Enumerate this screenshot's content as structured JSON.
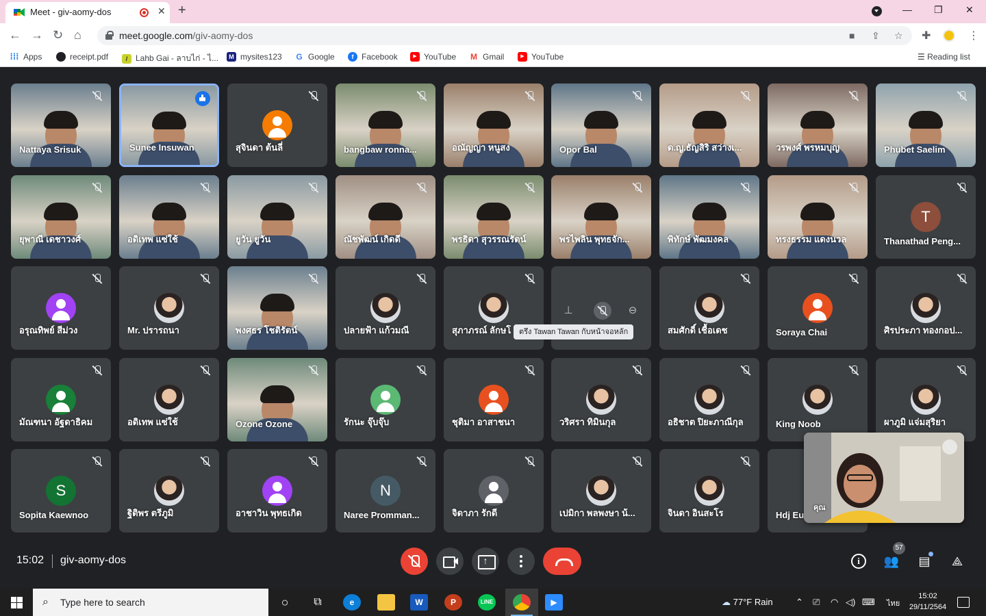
{
  "browser": {
    "tab_title": "Meet - giv-aomy-dos",
    "url_host": "meet.google.com",
    "url_path": "/giv-aomy-dos",
    "bookmarks": [
      "Apps",
      "receipt.pdf",
      "Lahb Gai - ลาบไก่ - ไ...",
      "mysites123",
      "Google",
      "Facebook",
      "YouTube",
      "Gmail",
      "YouTube"
    ],
    "reading_list": "Reading list"
  },
  "participants": [
    {
      "name": "Nattaya Srisuk",
      "kind": "video"
    },
    {
      "name": "Sunee Insuwan",
      "kind": "video",
      "speaking": true
    },
    {
      "name": "สุจินดา ต้นลี่",
      "kind": "avatar",
      "color": "#f57c00"
    },
    {
      "name": "bangbaw ronna...",
      "kind": "video"
    },
    {
      "name": "อณัญญา หนูสง",
      "kind": "video"
    },
    {
      "name": "Opor Bal",
      "kind": "video"
    },
    {
      "name": "ด.ญ.ธัญสิริ สว่างเ...",
      "kind": "video"
    },
    {
      "name": "วรพงศ์ พรหมบุญ",
      "kind": "video"
    },
    {
      "name": "Phubet Saelim",
      "kind": "video"
    },
    {
      "name": "ยุพาณี เดชาวงศ์",
      "kind": "video"
    },
    {
      "name": "อดิเทพ แซ่ใช้",
      "kind": "video"
    },
    {
      "name": "ยูวัน ยูวัน",
      "kind": "video"
    },
    {
      "name": "ณัชพัฒน์ เกิดดี",
      "kind": "video"
    },
    {
      "name": "พรธิดา สุวรรณรัตน์",
      "kind": "video"
    },
    {
      "name": "พรไพลิน พุทธจัก...",
      "kind": "video"
    },
    {
      "name": "พิทักษ์ พัฒมงคล",
      "kind": "video"
    },
    {
      "name": "ทรงธรรม แดงนวล",
      "kind": "video"
    },
    {
      "name": "Thanathad Peng...",
      "kind": "avatar",
      "letter": "T",
      "color": "#8d4e3c"
    },
    {
      "name": "อรุณทิพย์ สีม่วง",
      "kind": "avatar",
      "color": "#a142f4"
    },
    {
      "name": "Mr. ปรารถนา",
      "kind": "photo"
    },
    {
      "name": "พงศธร โชติรัตน์",
      "kind": "video"
    },
    {
      "name": "ปลายฟ้า แก้วมณี",
      "kind": "photo"
    },
    {
      "name": "สุภาภรณ์ ลักษโ",
      "kind": "photo"
    },
    {
      "name": "",
      "kind": "hover"
    },
    {
      "name": "สมศักดิ์ เชื้อเดช",
      "kind": "photo"
    },
    {
      "name": "Soraya Chai",
      "kind": "avatar",
      "color": "#e8511f"
    },
    {
      "name": "ศิรประภา ทองกอป...",
      "kind": "photo"
    },
    {
      "name": "มัณฑนา อัฐดาธิคม",
      "kind": "avatar",
      "color": "#188038"
    },
    {
      "name": "อดิเทพ แซ่ใช้",
      "kind": "photo"
    },
    {
      "name": "Ozone Ozone",
      "kind": "video"
    },
    {
      "name": "รักนะ จุ๊บจุ๊บ",
      "kind": "avatar",
      "color": "#5bb974"
    },
    {
      "name": "ชุติมา อาสาชนา",
      "kind": "avatar",
      "color": "#e8511f"
    },
    {
      "name": "วริศรา ทิมินกุล",
      "kind": "photo"
    },
    {
      "name": "อธิชาต ปิยะภาณีกุล",
      "kind": "photo"
    },
    {
      "name": "King Noob",
      "kind": "photo"
    },
    {
      "name": "ผาภูมิ แจ่มสุริยา",
      "kind": "photo"
    },
    {
      "name": "Sopita Kaewnoo",
      "kind": "avatar",
      "letter": "S",
      "color": "#137333"
    },
    {
      "name": "ฐิติพร ตรีภูมิ",
      "kind": "photo"
    },
    {
      "name": "อาชาวิน พุทธเกิด",
      "kind": "avatar",
      "color": "#a142f4"
    },
    {
      "name": "Naree Promman...",
      "kind": "avatar",
      "letter": "N",
      "color": "#455a64"
    },
    {
      "name": "จิดาภา รักดี",
      "kind": "avatar",
      "color": "#5f6368"
    },
    {
      "name": "เปมิกา พลพงษา น้...",
      "kind": "photo"
    },
    {
      "name": "จินดา อินสะโร",
      "kind": "photo"
    },
    {
      "name": "Hdj Eu",
      "kind": "avatar-hidden"
    }
  ],
  "tooltip": "ตรึง Tawan Tawan กับหน้าจอหลัก",
  "self_label": "คุณ",
  "meeting": {
    "time": "15:02",
    "code": "giv-aomy-dos",
    "participant_count": "57"
  },
  "taskbar": {
    "search_placeholder": "Type here to search",
    "weather": "77°F  Rain",
    "lang": "ไทย",
    "time": "15:02",
    "date": "29/11/2564"
  },
  "colors": {
    "meet_bg": "#202124",
    "tile_bg": "#3c4043",
    "danger": "#ea4335",
    "tab_strip": "#f6d6e4"
  }
}
